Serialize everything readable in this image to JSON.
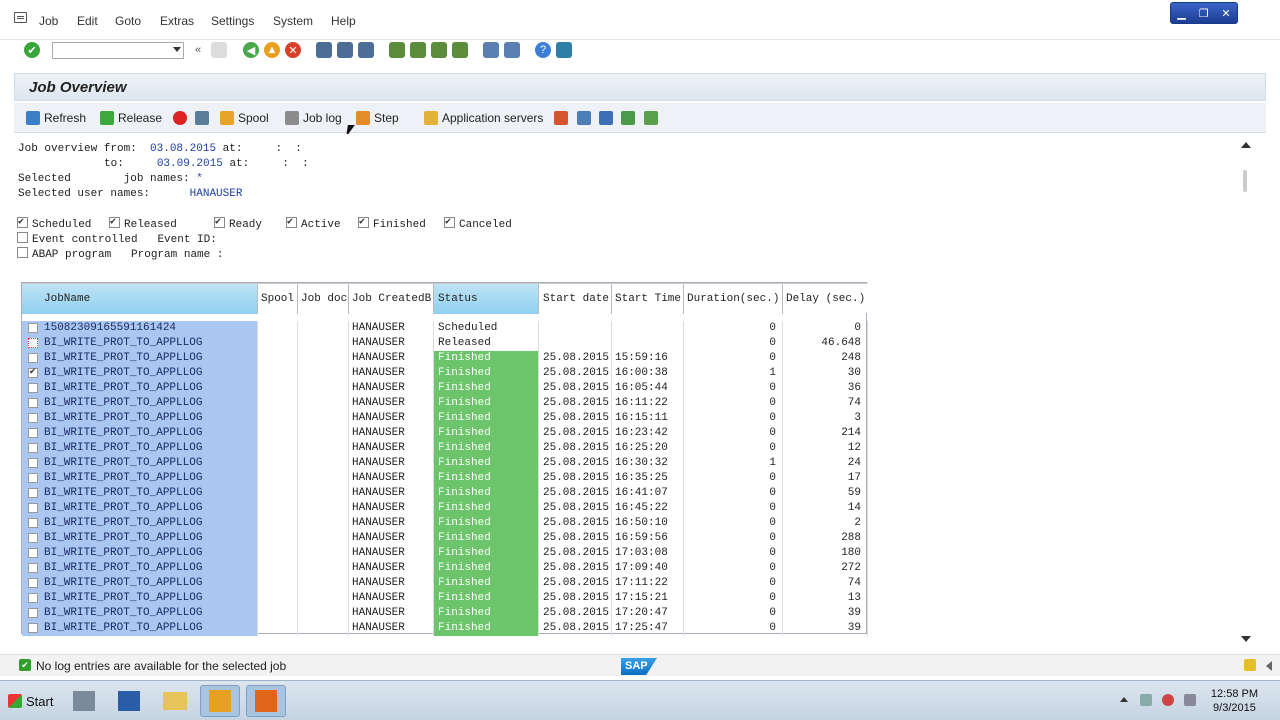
{
  "menubar": {
    "items": [
      "Job",
      "Edit",
      "Goto",
      "Extras",
      "Settings",
      "System",
      "Help"
    ]
  },
  "title": "Job Overview",
  "app_toolbar": {
    "refresh": "Refresh",
    "release": "Release",
    "spool": "Spool",
    "job_log": "Job log",
    "step": "Step",
    "app_servers": "Application servers"
  },
  "selection": {
    "from_label": "Job overview from:",
    "from_date": "03.08.2015",
    "from_at": "at:",
    "from_time": ":  :",
    "to_label": "to:",
    "to_date": "03.09.2015",
    "to_at": "at:",
    "to_time": ":  :",
    "selected_label": "Selected",
    "job_names_label": "job names:",
    "job_names_value": "*",
    "user_names_label": "Selected user names:",
    "user_names_value": "HANAUSER"
  },
  "status_filters": [
    {
      "label": "Scheduled",
      "checked": true
    },
    {
      "label": "Released",
      "checked": true
    },
    {
      "label": "Ready",
      "checked": true
    },
    {
      "label": "Active",
      "checked": true
    },
    {
      "label": "Finished",
      "checked": true
    },
    {
      "label": "Canceled",
      "checked": true
    }
  ],
  "event_controlled": {
    "label": "Event controlled",
    "event_id_label": "Event ID:",
    "checked": false
  },
  "abap_program": {
    "label": "ABAP program",
    "program_label": "Program name :",
    "checked": false
  },
  "table": {
    "columns": [
      "JobName",
      "Spool",
      "Job doc",
      "Job CreatedB",
      "Status",
      "Start date",
      "Start Time",
      "Duration(sec.)",
      "Delay (sec.)"
    ],
    "rows": [
      {
        "name": "15082309165591161424",
        "spool": "",
        "doc": "",
        "created": "HANAUSER",
        "status": "Scheduled",
        "date": "",
        "time": "",
        "duration": "0",
        "delay": "0",
        "checked": false
      },
      {
        "name": "BI_WRITE_PROT_TO_APPLLOG",
        "spool": "",
        "doc": "",
        "created": "HANAUSER",
        "status": "Released",
        "date": "",
        "time": "",
        "duration": "0",
        "delay": "46.648",
        "checked": false
      },
      {
        "name": "BI_WRITE_PROT_TO_APPLLOG",
        "spool": "",
        "doc": "",
        "created": "HANAUSER",
        "status": "Finished",
        "date": "25.08.2015",
        "time": "15:59:16",
        "duration": "0",
        "delay": "248",
        "checked": false
      },
      {
        "name": "BI_WRITE_PROT_TO_APPLLOG",
        "spool": "",
        "doc": "",
        "created": "HANAUSER",
        "status": "Finished",
        "date": "25.08.2015",
        "time": "16:00:38",
        "duration": "1",
        "delay": "30",
        "checked": true
      },
      {
        "name": "BI_WRITE_PROT_TO_APPLLOG",
        "spool": "",
        "doc": "",
        "created": "HANAUSER",
        "status": "Finished",
        "date": "25.08.2015",
        "time": "16:05:44",
        "duration": "0",
        "delay": "36",
        "checked": false
      },
      {
        "name": "BI_WRITE_PROT_TO_APPLLOG",
        "spool": "",
        "doc": "",
        "created": "HANAUSER",
        "status": "Finished",
        "date": "25.08.2015",
        "time": "16:11:22",
        "duration": "0",
        "delay": "74",
        "checked": false
      },
      {
        "name": "BI_WRITE_PROT_TO_APPLLOG",
        "spool": "",
        "doc": "",
        "created": "HANAUSER",
        "status": "Finished",
        "date": "25.08.2015",
        "time": "16:15:11",
        "duration": "0",
        "delay": "3",
        "checked": false
      },
      {
        "name": "BI_WRITE_PROT_TO_APPLLOG",
        "spool": "",
        "doc": "",
        "created": "HANAUSER",
        "status": "Finished",
        "date": "25.08.2015",
        "time": "16:23:42",
        "duration": "0",
        "delay": "214",
        "checked": false
      },
      {
        "name": "BI_WRITE_PROT_TO_APPLLOG",
        "spool": "",
        "doc": "",
        "created": "HANAUSER",
        "status": "Finished",
        "date": "25.08.2015",
        "time": "16:25:20",
        "duration": "0",
        "delay": "12",
        "checked": false
      },
      {
        "name": "BI_WRITE_PROT_TO_APPLLOG",
        "spool": "",
        "doc": "",
        "created": "HANAUSER",
        "status": "Finished",
        "date": "25.08.2015",
        "time": "16:30:32",
        "duration": "1",
        "delay": "24",
        "checked": false
      },
      {
        "name": "BI_WRITE_PROT_TO_APPLLOG",
        "spool": "",
        "doc": "",
        "created": "HANAUSER",
        "status": "Finished",
        "date": "25.08.2015",
        "time": "16:35:25",
        "duration": "0",
        "delay": "17",
        "checked": false
      },
      {
        "name": "BI_WRITE_PROT_TO_APPLLOG",
        "spool": "",
        "doc": "",
        "created": "HANAUSER",
        "status": "Finished",
        "date": "25.08.2015",
        "time": "16:41:07",
        "duration": "0",
        "delay": "59",
        "checked": false
      },
      {
        "name": "BI_WRITE_PROT_TO_APPLLOG",
        "spool": "",
        "doc": "",
        "created": "HANAUSER",
        "status": "Finished",
        "date": "25.08.2015",
        "time": "16:45:22",
        "duration": "0",
        "delay": "14",
        "checked": false
      },
      {
        "name": "BI_WRITE_PROT_TO_APPLLOG",
        "spool": "",
        "doc": "",
        "created": "HANAUSER",
        "status": "Finished",
        "date": "25.08.2015",
        "time": "16:50:10",
        "duration": "0",
        "delay": "2",
        "checked": false
      },
      {
        "name": "BI_WRITE_PROT_TO_APPLLOG",
        "spool": "",
        "doc": "",
        "created": "HANAUSER",
        "status": "Finished",
        "date": "25.08.2015",
        "time": "16:59:56",
        "duration": "0",
        "delay": "288",
        "checked": false
      },
      {
        "name": "BI_WRITE_PROT_TO_APPLLOG",
        "spool": "",
        "doc": "",
        "created": "HANAUSER",
        "status": "Finished",
        "date": "25.08.2015",
        "time": "17:03:08",
        "duration": "0",
        "delay": "180",
        "checked": false
      },
      {
        "name": "BI_WRITE_PROT_TO_APPLLOG",
        "spool": "",
        "doc": "",
        "created": "HANAUSER",
        "status": "Finished",
        "date": "25.08.2015",
        "time": "17:09:40",
        "duration": "0",
        "delay": "272",
        "checked": false
      },
      {
        "name": "BI_WRITE_PROT_TO_APPLLOG",
        "spool": "",
        "doc": "",
        "created": "HANAUSER",
        "status": "Finished",
        "date": "25.08.2015",
        "time": "17:11:22",
        "duration": "0",
        "delay": "74",
        "checked": false
      },
      {
        "name": "BI_WRITE_PROT_TO_APPLLOG",
        "spool": "",
        "doc": "",
        "created": "HANAUSER",
        "status": "Finished",
        "date": "25.08.2015",
        "time": "17:15:21",
        "duration": "0",
        "delay": "13",
        "checked": false
      },
      {
        "name": "BI_WRITE_PROT_TO_APPLLOG",
        "spool": "",
        "doc": "",
        "created": "HANAUSER",
        "status": "Finished",
        "date": "25.08.2015",
        "time": "17:20:47",
        "duration": "0",
        "delay": "39",
        "checked": false
      },
      {
        "name": "BI_WRITE_PROT_TO_APPLLOG",
        "spool": "",
        "doc": "",
        "created": "HANAUSER",
        "status": "Finished",
        "date": "25.08.2015",
        "time": "17:25:47",
        "duration": "0",
        "delay": "39",
        "checked": false
      }
    ]
  },
  "status_bar": {
    "message": "No log entries are available for the selected job",
    "logo": "SAP"
  },
  "taskbar": {
    "start": "Start",
    "time": "12:58 PM",
    "date": "9/3/2015"
  },
  "colors": {
    "finished": "#6cc56a",
    "name_cell": "#a9c7f0",
    "header": "#8fd0ef"
  }
}
